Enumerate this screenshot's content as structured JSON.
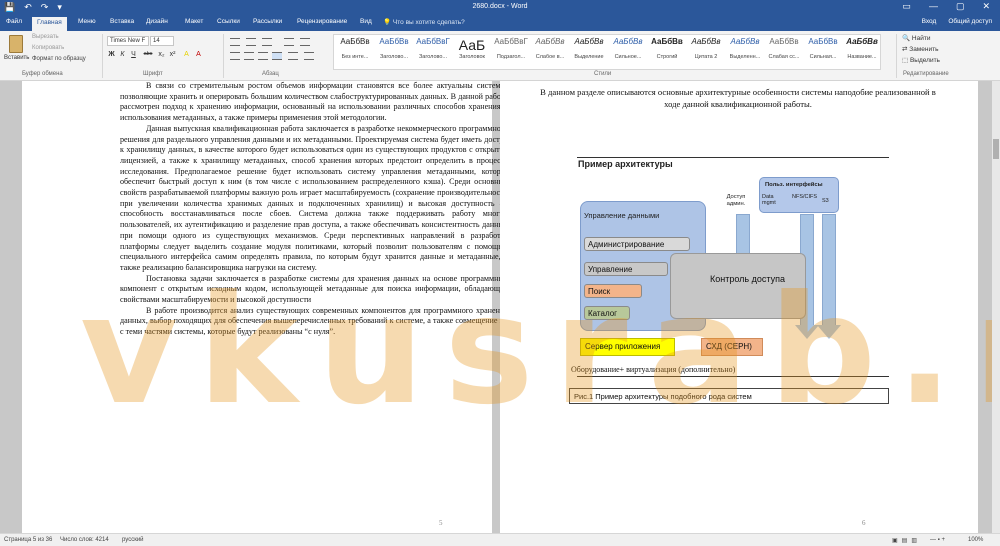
{
  "window": {
    "title": "2680.docx - Word",
    "quick_access": [
      "💾",
      "↶",
      "↷",
      "▾"
    ],
    "controls": [
      "▭",
      "—",
      "▢",
      "✕"
    ]
  },
  "tabs": {
    "file": "Файл",
    "items": [
      "Главная",
      "Меню",
      "Вставка",
      "Дизайн",
      "Макет",
      "Ссылки",
      "Рассылки",
      "Рецензирование",
      "Вид"
    ],
    "tell_me": "Что вы хотите сделать?",
    "sign_in": "Вход",
    "share": "Общий доступ"
  },
  "ribbon": {
    "clipboard": {
      "paste": "Вставить",
      "cut": "Вырезать",
      "copy": "Копировать",
      "format_painter": "Формат по образцу",
      "label": "Буфер обмена"
    },
    "font": {
      "name": "Times New F",
      "size": "14",
      "label": "Шрифт",
      "buttons": [
        "Ж",
        "К",
        "Ч",
        "abc",
        "x₂",
        "x²",
        "A",
        "A"
      ]
    },
    "paragraph": {
      "label": "Абзац"
    },
    "styles": {
      "label": "Стили",
      "items": [
        {
          "sample": "АаБбВв",
          "name": "Без инте..."
        },
        {
          "sample": "АаБбВв",
          "name": "Заголово..."
        },
        {
          "sample": "АаБбВвГ",
          "name": "Заголово..."
        },
        {
          "sample": "АаБ",
          "name": "Заголовок"
        },
        {
          "sample": "АаБбВвГ",
          "name": "Подзагол..."
        },
        {
          "sample": "АаБбВв",
          "name": "Слабое в..."
        },
        {
          "sample": "АаБбВв",
          "name": "Выделение"
        },
        {
          "sample": "АаБбВв",
          "name": "Сильное..."
        },
        {
          "sample": "АаБбВв",
          "name": "Строгий"
        },
        {
          "sample": "АаБбВв",
          "name": "Цитата 2"
        },
        {
          "sample": "АаБбВв",
          "name": "Выделенн..."
        },
        {
          "sample": "АаБбВв",
          "name": "Слабая сс..."
        },
        {
          "sample": "АаБбВв",
          "name": "Сильная..."
        },
        {
          "sample": "АаБбВв",
          "name": "Название..."
        }
      ]
    },
    "editing": {
      "find": "Найти",
      "replace": "Заменить",
      "select": "Выделить",
      "label": "Редактирование"
    }
  },
  "page1": {
    "paragraphs": [
      "В связи со стремительным ростом объемов информации становятся все более актуальны системы, позволяющие хранить и оперировать большим количеством слабоструктурированных данных. В данной работе рассмотрен подход к хранению информации, основанный на использовании различных способов хранения и использования метаданных, а также примеры применения этой методологии.",
      "Данная выпускная квалификационная работа заключается в разработке некоммерческого программного решения для раздельного управления данными и их метаданными. Проектируемая система будет иметь доступ к хранилищу данных, в качестве которого будет использоваться один из существующих продуктов с открытой лицензией, а также к хранилищу метаданных, способ хранения которых предстоит определить в процессе исследования. Предполагаемое решение будет использовать систему управления метаданными, которая обеспечит быстрый доступ к ним (в том числе с использованием распределенного кэша). Среди основных свойств разрабатываемой платформы важную роль играет масштабируемость (сохранение производительности при увеличении количества хранимых данных и подключенных хранилищ) и высокая доступность — способность восстанавливаться после сбоев. Система должна также поддерживать работу многих пользователей, их аутентификацию и разделение прав доступа, а также обеспечивать консистентность данных при помощи одного из существующих механизмов. Среди перспективных направлений в разработке платформы следует выделить создание модуля политиками, который позволит пользователям с помощью специального интерфейса самим определять правила, по которым будут хранится данные и метаданные, а также реализацию балансировщика нагрузки на систему.",
      "Постановка задачи заключается в разработке системы для хранения данных на основе программных компонент с открытым исходным кодом, использующей метаданные для поиска информации, обладающей свойствами масштабируемости и высокой доступности",
      "В работе производится анализ существующих современных компонентов для программного хранения данных, выбор походящих для обеспечения вышеперечисленных требований к системе, а также совмещение их с теми частями системы, которые будут реализованы “с нуля”."
    ],
    "page_number": "5"
  },
  "page2": {
    "intro": "В данном разделе описываются основные архитектурные особенности системы наподобие реализованной в ходе данной квалификационной работы.",
    "diagram": {
      "title": "Пример архитектуры",
      "data_management": "Управление данными",
      "items": [
        "Администрирование",
        "Управление",
        "Поиск",
        "Каталог"
      ],
      "ui_title": "Польз. интерфейсы",
      "ui_cells": [
        "Data mgmt",
        "NFS/CIFS",
        "S3"
      ],
      "access_admin": "Доступ админ.",
      "access_control": "Контроль доступа",
      "app_server": "Сервер приложения",
      "dbms": "СХД (СЕРН)",
      "hardware": "Оборудование+ виртуализация (дополнительно)"
    },
    "caption": "Рис.1 Пример архитектуры подобного рода систем",
    "page_number": "6"
  },
  "watermark": "vkusrab.ru",
  "status": {
    "page": "Страница 5 из 36",
    "words": "Число слов: 4214",
    "language": "русский",
    "zoom": "100%"
  }
}
